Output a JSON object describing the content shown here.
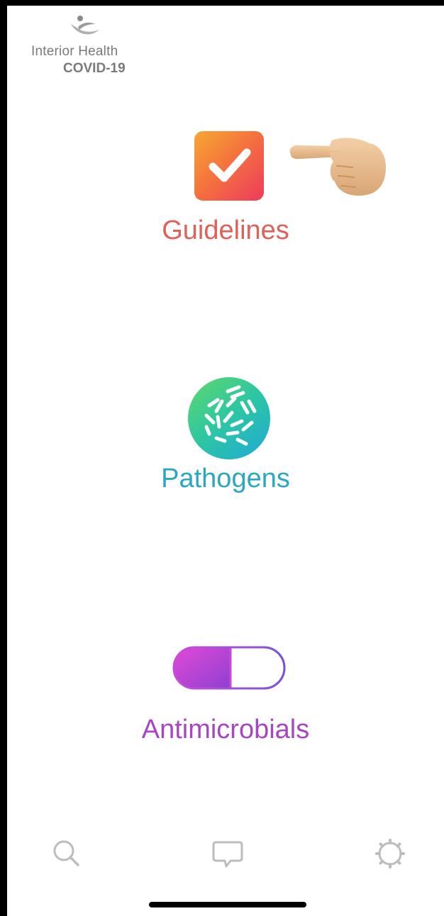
{
  "logo": {
    "line1": "Interior Health",
    "line2": "COVID-19"
  },
  "menu": {
    "guidelines": {
      "label": "Guidelines",
      "icon": "checkbox-icon",
      "color": "#e0605a"
    },
    "pathogens": {
      "label": "Pathogens",
      "icon": "bacteria-icon",
      "color": "#2aa8c2"
    },
    "antimicrobials": {
      "label": "Antimicrobials",
      "icon": "pill-capsule-icon",
      "color": "#a746c4"
    }
  },
  "pointer": {
    "icon": "pointing-hand-icon"
  },
  "tabbar": {
    "items": [
      {
        "icon": "search-icon"
      },
      {
        "icon": "chat-bubble-icon"
      },
      {
        "icon": "gear-icon"
      }
    ]
  }
}
